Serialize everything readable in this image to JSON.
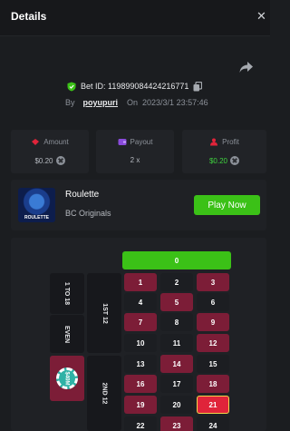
{
  "header": {
    "title": "Details",
    "close_icon": "close-icon"
  },
  "bet": {
    "id_text": "Bet ID: 119899084424216771",
    "by_label": "By",
    "username": "poyupuri",
    "on_label": "On",
    "datetime": "2023/3/1 23:57:46"
  },
  "stats": {
    "amount": {
      "label": "Amount",
      "value": "$0.20"
    },
    "payout": {
      "label": "Payout",
      "value": "2 x"
    },
    "profit": {
      "label": "Profit",
      "value": "$0.20"
    }
  },
  "game": {
    "name": "Roulette",
    "provider": "BC Originals",
    "thumb_text": "ROULETTE",
    "play_label": "Play Now"
  },
  "roulette": {
    "zero": "0",
    "rows": [
      [
        "1",
        "2",
        "3"
      ],
      [
        "4",
        "5",
        "6"
      ],
      [
        "7",
        "8",
        "9"
      ],
      [
        "10",
        "11",
        "12"
      ],
      [
        "13",
        "14",
        "15"
      ],
      [
        "16",
        "17",
        "18"
      ],
      [
        "19",
        "20",
        "21"
      ],
      [
        "22",
        "23",
        "24"
      ]
    ],
    "side_labels": {
      "one_to_18": "1 TO 18",
      "first_12": "1ST 12",
      "even": "EVEN",
      "second_12": "2ND 12"
    },
    "chip_value": "$40M"
  },
  "colors": {
    "accent_green": "#3bc117",
    "red_cell": "#7c1d37",
    "winning_cell": "#e0243a"
  }
}
